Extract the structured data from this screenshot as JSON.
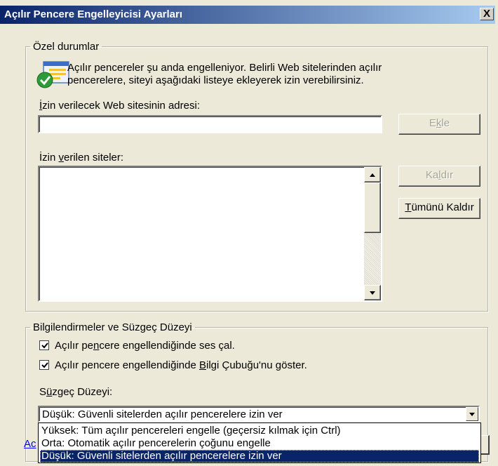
{
  "window": {
    "title": "Açılır Pencere Engelleyicisi Ayarları",
    "close_label": "X"
  },
  "exceptions": {
    "legend": "Özel durumlar",
    "info_line1": "Açılır pencereler şu anda engelleniyor.  Belirli Web sitelerinden açılır",
    "info_line2": "pencerelere, siteyi aşağıdaki listeye ekleyerek izin verebilirsiniz.",
    "address_label_pre": "",
    "address_label_u": "İ",
    "address_label_post": "zin verilecek Web sitesinin adresi:",
    "address_value": "",
    "add_button_pre": "E",
    "add_button_u": "k",
    "add_button_post": "le",
    "allowed_label_pre": "İzin ",
    "allowed_label_u": "v",
    "allowed_label_post": "erilen siteler:",
    "allowed_sites": [],
    "remove_button_pre": "Ka",
    "remove_button_u": "l",
    "remove_button_post": "dır",
    "remove_all_pre": "",
    "remove_all_u": "T",
    "remove_all_post": "ümünü Kaldır"
  },
  "notifications": {
    "legend": "Bilgilendirmeler ve Süzgeç Düzeyi",
    "sound_pre": "Açılır pe",
    "sound_u": "n",
    "sound_post": "cere engellendiğinde ses çal.",
    "sound_checked": true,
    "infobar_pre": "Açılır pencere engellendiğinde ",
    "infobar_u": "B",
    "infobar_post": "ilgi Çubuğu'nu göster.",
    "infobar_checked": true,
    "filter_label_pre": "S",
    "filter_label_u": "ü",
    "filter_label_post": "zgeç Düzeyi:",
    "filter_selected": "Düşük: Güvenli sitelerden açılır pencerelere izin ver",
    "filter_options": [
      "Yüksek: Tüm açılır pencereleri engelle (geçersiz kılmak için Ctrl)",
      "Orta: Otomatik açılır pencerelerin çoğunu engelle",
      "Düşük: Güvenli sitelerden açılır pencerelere izin ver"
    ],
    "selected_index": 2
  },
  "footer": {
    "link_partial": "Ac"
  },
  "colors": {
    "title_start": "#0a246a",
    "title_end": "#a6caf0",
    "face": "#ece9d8",
    "highlight": "#0a246a"
  }
}
